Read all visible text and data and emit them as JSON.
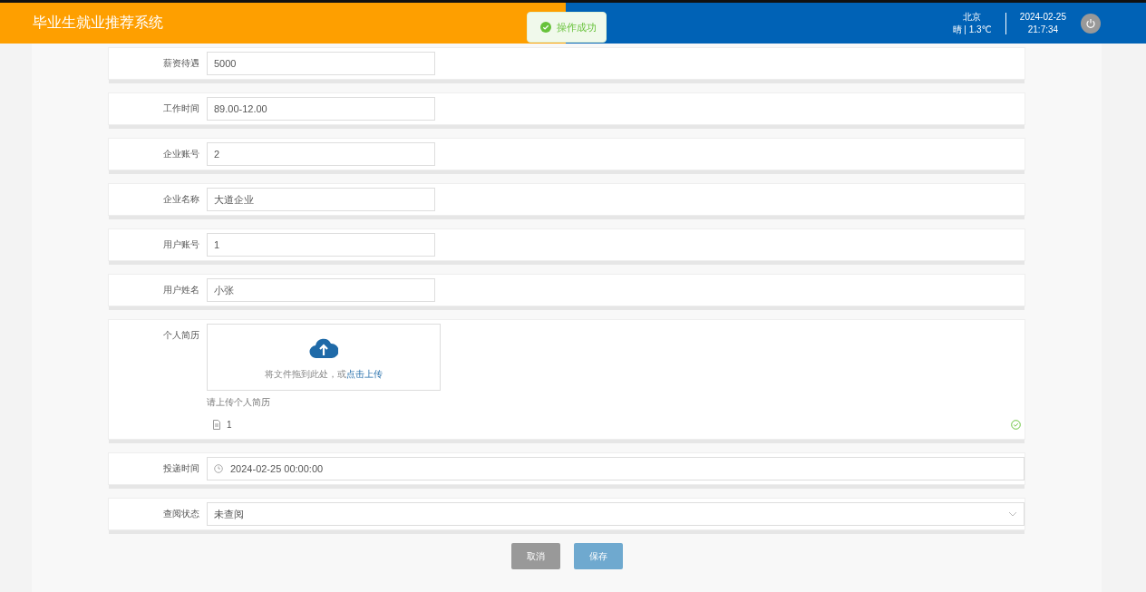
{
  "header": {
    "title": "毕业生就业推荐系统",
    "city": "北京",
    "weather": "晴 | 1.3℃",
    "date": "2024-02-25",
    "time": "21:7:34"
  },
  "toast": {
    "text": "操作成功"
  },
  "fields": [
    {
      "kind": "text",
      "label": "薪资待遇",
      "value": "5000"
    },
    {
      "kind": "text",
      "label": "工作时间",
      "value": "89.00-12.00"
    },
    {
      "kind": "text",
      "label": "企业账号",
      "value": "2"
    },
    {
      "kind": "text",
      "label": "企业名称",
      "value": "大道企业"
    },
    {
      "kind": "text",
      "label": "用户账号",
      "value": "1"
    },
    {
      "kind": "text",
      "label": "用户姓名",
      "value": "小张"
    },
    {
      "kind": "upload",
      "label": "个人简历",
      "drop_text": "将文件拖到此处，或",
      "link": "点击上传",
      "tip": "请上传个人简历",
      "file": "1"
    },
    {
      "kind": "date",
      "label": "投递时间",
      "value": "2024-02-25 00:00:00"
    },
    {
      "kind": "select",
      "label": "查阅状态",
      "value": "未查阅"
    }
  ],
  "buttons": [
    {
      "kind": "cancel",
      "label": "取消"
    },
    {
      "kind": "save",
      "label": "保存"
    }
  ]
}
